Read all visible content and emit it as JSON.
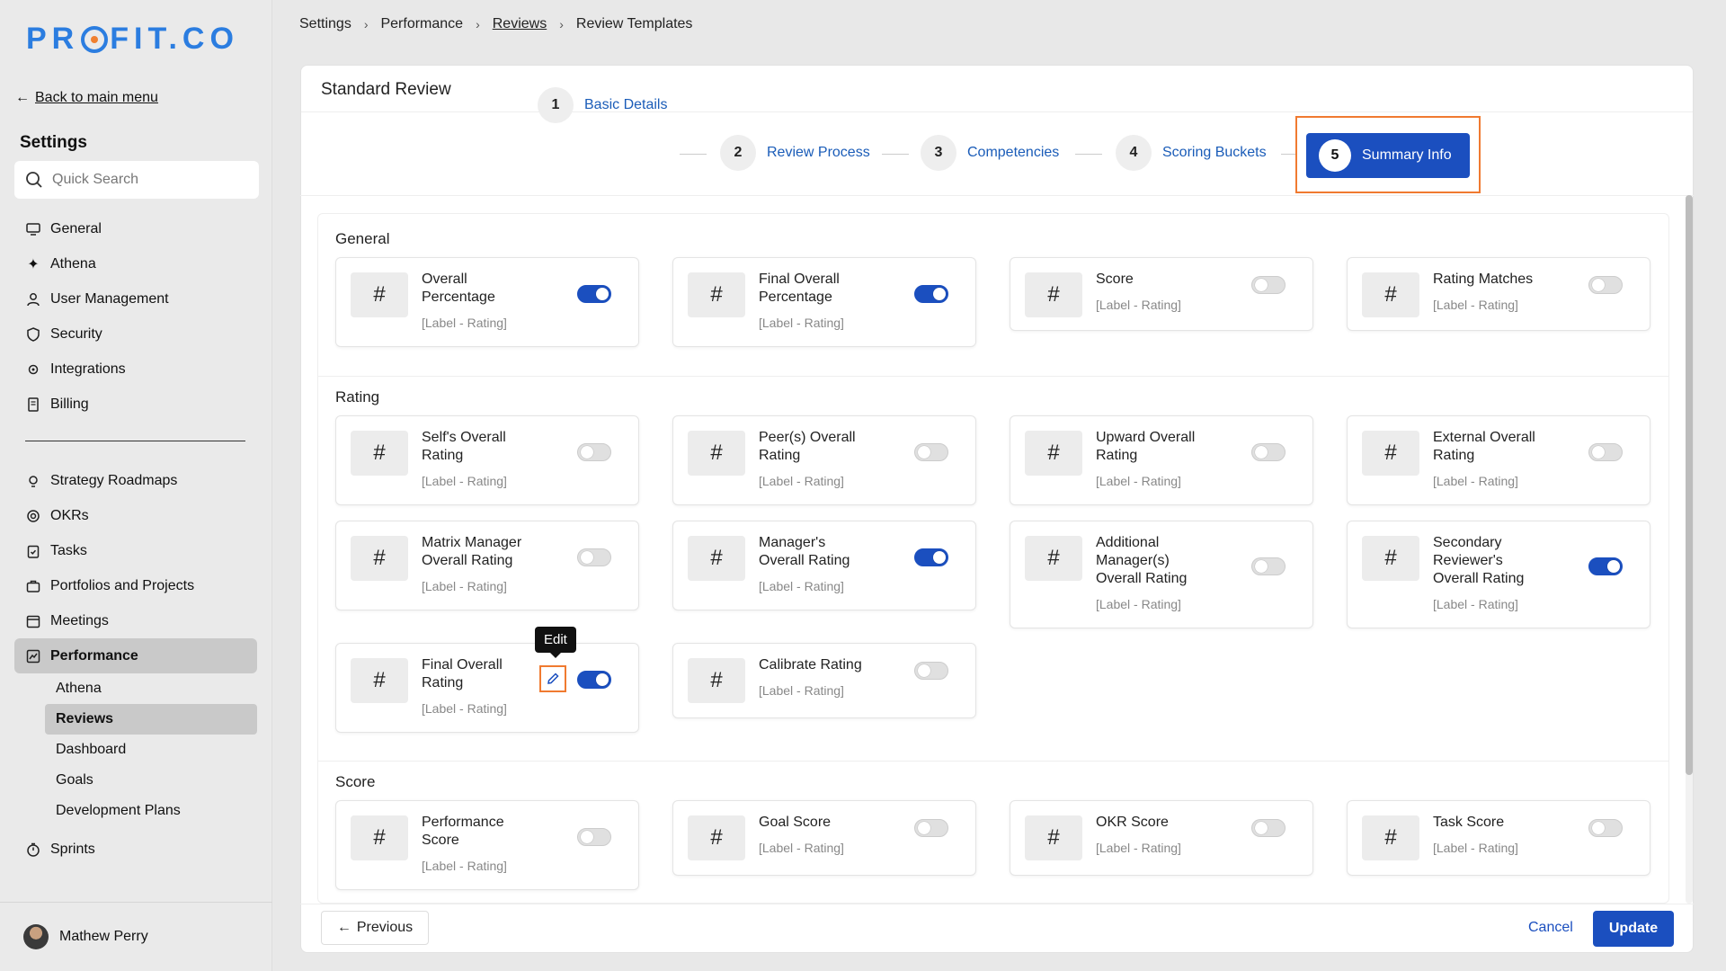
{
  "sidebar": {
    "logo": "PROFIT.CO",
    "back_label": "Back to main menu",
    "settings_title": "Settings",
    "search_placeholder": "Quick Search",
    "top_items": [
      {
        "label": "General",
        "icon": "monitor-icon"
      },
      {
        "label": "Athena",
        "icon": "sparkle-icon"
      },
      {
        "label": "User Management",
        "icon": "user-icon"
      },
      {
        "label": "Security",
        "icon": "shield-icon"
      },
      {
        "label": "Integrations",
        "icon": "gear-icon"
      },
      {
        "label": "Billing",
        "icon": "receipt-icon"
      }
    ],
    "module_items": [
      {
        "label": "Strategy Roadmaps",
        "icon": "bulb-icon"
      },
      {
        "label": "OKRs",
        "icon": "target-icon"
      },
      {
        "label": "Tasks",
        "icon": "clipboard-icon"
      },
      {
        "label": "Portfolios and Projects",
        "icon": "briefcase-icon"
      },
      {
        "label": "Meetings",
        "icon": "calendar-icon"
      },
      {
        "label": "Performance",
        "icon": "chart-icon",
        "active": true
      }
    ],
    "performance_sub": [
      "Athena",
      "Reviews",
      "Dashboard",
      "Goals",
      "Development Plans"
    ],
    "active_sub": "Reviews",
    "sprints": "Sprints",
    "user_name": "Mathew Perry"
  },
  "breadcrumb": [
    "Settings",
    "Performance",
    "Reviews",
    "Review Templates"
  ],
  "card": {
    "title": "Standard Review",
    "steps": [
      {
        "num": "1",
        "label": "Basic Details"
      },
      {
        "num": "2",
        "label": "Review Process"
      },
      {
        "num": "3",
        "label": "Competencies"
      },
      {
        "num": "4",
        "label": "Scoring Buckets"
      },
      {
        "num": "5",
        "label": "Summary Info"
      }
    ]
  },
  "sections": {
    "general": {
      "title": "General",
      "items": [
        {
          "name": "Overall Percentage",
          "sub": "[Label - Rating]",
          "on": true
        },
        {
          "name": "Final Overall Percentage",
          "sub": "[Label - Rating]",
          "on": true
        },
        {
          "name": "Score",
          "sub": "[Label - Rating]",
          "on": false
        },
        {
          "name": "Rating Matches",
          "sub": "[Label - Rating]",
          "on": false
        }
      ]
    },
    "rating": {
      "title": "Rating",
      "items": [
        {
          "name": "Self's Overall Rating",
          "sub": "[Label - Rating]",
          "on": false
        },
        {
          "name": "Peer(s) Overall Rating",
          "sub": "[Label - Rating]",
          "on": false
        },
        {
          "name": "Upward Overall Rating",
          "sub": "[Label - Rating]",
          "on": false
        },
        {
          "name": "External Overall Rating",
          "sub": "[Label - Rating]",
          "on": false
        },
        {
          "name": "Matrix Manager Overall Rating",
          "sub": "[Label - Rating]",
          "on": false
        },
        {
          "name": "Manager's Overall Rating",
          "sub": "[Label - Rating]",
          "on": true
        },
        {
          "name": "Additional Manager(s) Overall Rating",
          "sub": "[Label - Rating]",
          "on": false
        },
        {
          "name": "Secondary Reviewer's Overall Rating",
          "sub": "[Label - Rating]",
          "on": true
        },
        {
          "name": "Final Overall Rating",
          "sub": "[Label - Rating]",
          "on": true
        },
        {
          "name": "Calibrate Rating",
          "sub": "[Label - Rating]",
          "on": false
        }
      ]
    },
    "score": {
      "title": "Score",
      "items": [
        {
          "name": "Performance Score",
          "sub": "[Label - Rating]",
          "on": false
        },
        {
          "name": "Goal Score",
          "sub": "[Label - Rating]",
          "on": false
        },
        {
          "name": "OKR Score",
          "sub": "[Label - Rating]",
          "on": false
        },
        {
          "name": "Task Score",
          "sub": "[Label - Rating]",
          "on": false
        }
      ]
    }
  },
  "hash_symbol": "#",
  "tooltip": "Edit",
  "footer": {
    "previous": "Previous",
    "cancel": "Cancel",
    "update": "Update"
  },
  "colors": {
    "accent": "#1b4fbf",
    "highlight": "#f07a30",
    "logo": "#2b7de0"
  }
}
